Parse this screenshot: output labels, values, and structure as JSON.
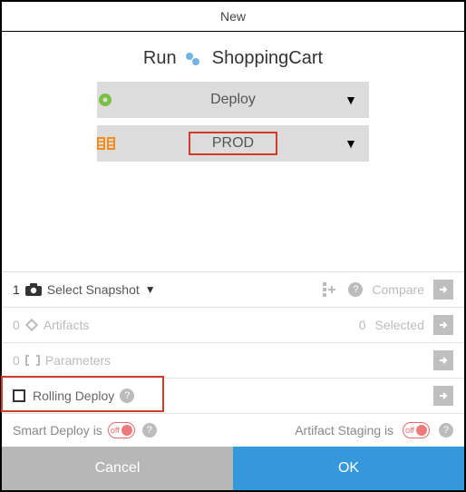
{
  "title": "New",
  "header": {
    "run_label": "Run",
    "app_name": "ShoppingCart"
  },
  "dropdowns": {
    "action": "Deploy",
    "environment": "PROD"
  },
  "snapshot": {
    "count": "1",
    "label": "Select Snapshot",
    "compare": "Compare"
  },
  "artifacts": {
    "count": "0",
    "label": "Artifacts",
    "selected_count": "0",
    "selected_label": "Selected"
  },
  "parameters": {
    "count": "0",
    "label": "Parameters"
  },
  "rolling_deploy": {
    "label": "Rolling Deploy"
  },
  "smart_deploy": {
    "label": "Smart Deploy is",
    "state": "off"
  },
  "artifact_staging": {
    "label": "Artifact Staging is",
    "state": "off"
  },
  "buttons": {
    "cancel": "Cancel",
    "ok": "OK"
  }
}
